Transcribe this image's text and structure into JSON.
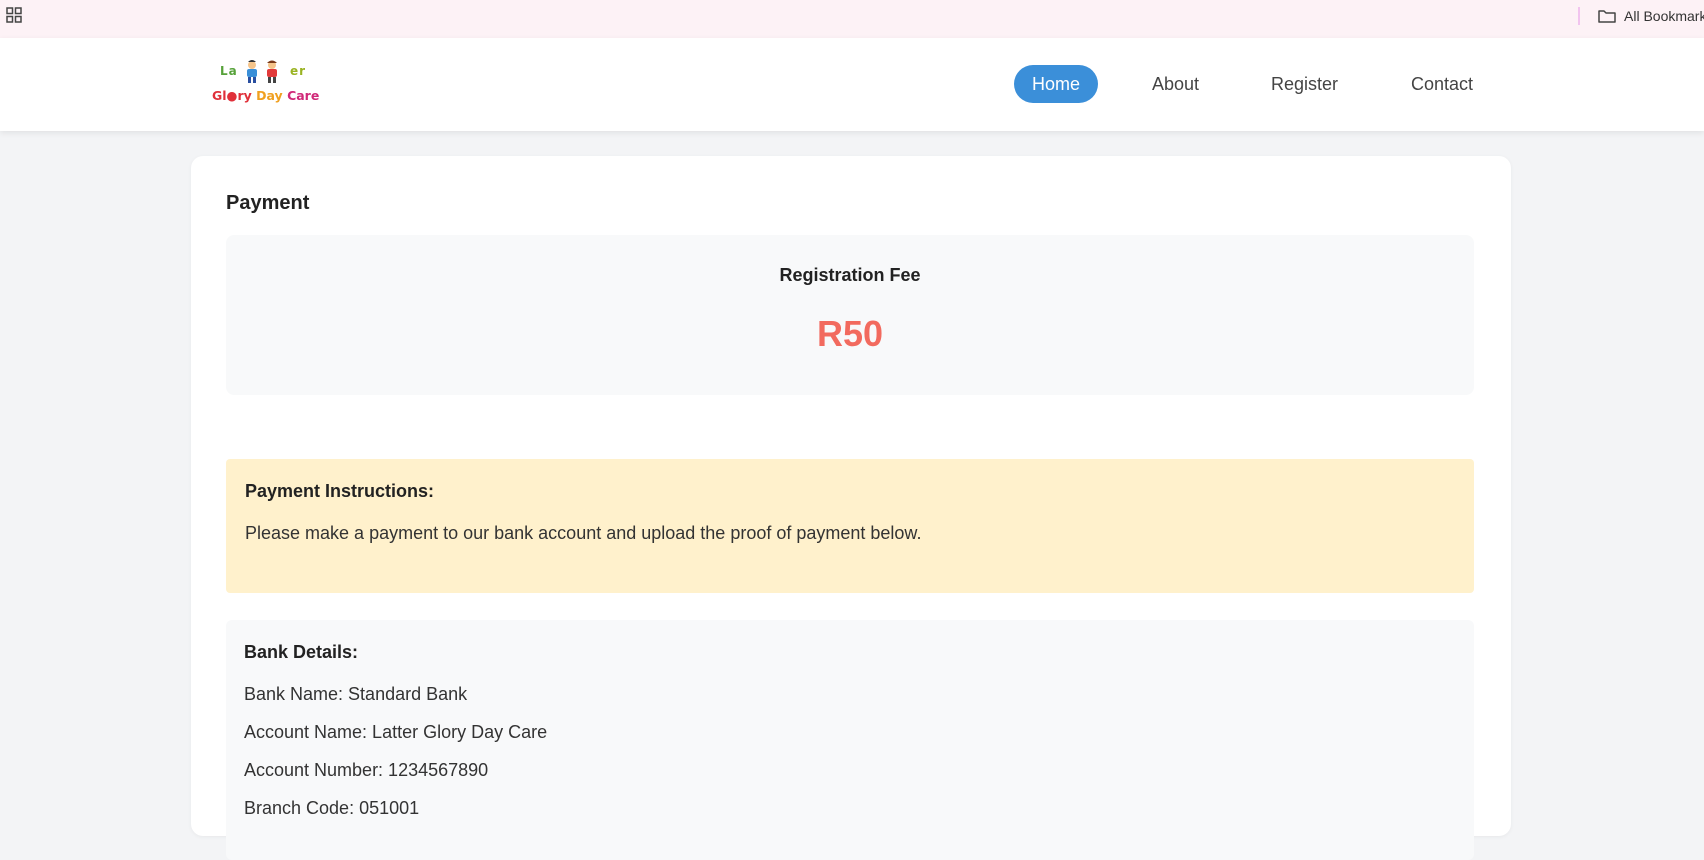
{
  "browser": {
    "apps_icon": "apps-grid-icon",
    "bookmarks_label": "All Bookmarks",
    "bookmarks_icon": "folder-icon"
  },
  "logo": {
    "top_left": "La",
    "top_right": "er",
    "bottom_glory": "Gl●ry",
    "bottom_day": "Day",
    "bottom_care": "Care"
  },
  "nav": {
    "home": "Home",
    "about": "About",
    "register": "Register",
    "contact": "Contact",
    "active": "Home",
    "active_color": "#3b8fd9"
  },
  "payment": {
    "title": "Payment",
    "fee_label": "Registration Fee",
    "fee_amount": "R50",
    "fee_color": "#f26a5e"
  },
  "instructions": {
    "heading": "Payment Instructions:",
    "text": "Please make a payment to our bank account and upload the proof of payment below."
  },
  "bank": {
    "heading": "Bank Details:",
    "bank_name": "Bank Name: Standard Bank",
    "account_name": "Account Name: Latter Glory Day Care",
    "account_number": "Account Number: 1234567890",
    "branch_code": "Branch Code: 051001"
  }
}
